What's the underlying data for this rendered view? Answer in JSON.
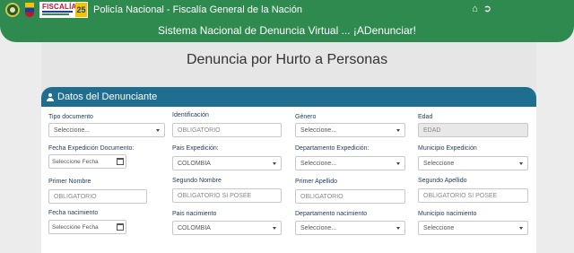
{
  "header": {
    "title": "Policía Nacional - Fiscalía General de la Nación",
    "logo_fiscalia_text": "FISCALÍA",
    "logo_fiscalia_badge": "25",
    "icons": [
      "home-icon",
      "logout-icon"
    ]
  },
  "banner": {
    "text": "Sistema Nacional de Denuncia Virtual ... ¡ADenunciar!"
  },
  "page": {
    "title": "Denuncia por Hurto a Personas"
  },
  "section": {
    "title": "Datos del Denunciante"
  },
  "form": {
    "tipo_documento": {
      "label": "Tipo documento",
      "value": "Seleccione..."
    },
    "identificacion": {
      "label": "Identificación",
      "placeholder": "OBLIGATORIO"
    },
    "genero": {
      "label": "Género",
      "value": "Seleccione..."
    },
    "edad": {
      "label": "Edad",
      "placeholder": "EDAD"
    },
    "fecha_expedicion": {
      "label": "Fecha Expedición Documento:",
      "placeholder": "Seleccione Fecha"
    },
    "pais_expedicion": {
      "label": "Pais Expedición:",
      "value": "COLOMBIA"
    },
    "departamento_expedicion": {
      "label": "Departamento Expedición:",
      "value": "Seleccione..."
    },
    "municipio_expedicion": {
      "label": "Municipio Expedición",
      "value": "Seleccione"
    },
    "primer_nombre": {
      "label": "Primer Nombre",
      "placeholder": "OBLIGATORIO"
    },
    "segundo_nombre": {
      "label": "Segundo Nombre",
      "placeholder": "OBLIGATORIO SI POSEE"
    },
    "primer_apellido": {
      "label": "Primer Apellido",
      "placeholder": "OBLIGATORIO"
    },
    "segundo_apellido": {
      "label": "Segundo Apellido",
      "placeholder": "OBLIGATORIO SI POSEE"
    },
    "fecha_nacimiento": {
      "label": "Fecha nacimiento",
      "placeholder": "Seleccione Fecha"
    },
    "pais_nacimiento": {
      "label": "Pais nacimiento",
      "value": "COLOMBIA"
    },
    "departamento_nacimiento": {
      "label": "Departamento nacimiento",
      "value": "Seleccione..."
    },
    "municipio_nacimiento": {
      "label": "Municipio nacimiento",
      "value": "Seleccione"
    }
  },
  "colors": {
    "header_green": "#2e8a4e",
    "section_blue": "#1f6d8f",
    "label_navy": "#1f3a5a"
  }
}
